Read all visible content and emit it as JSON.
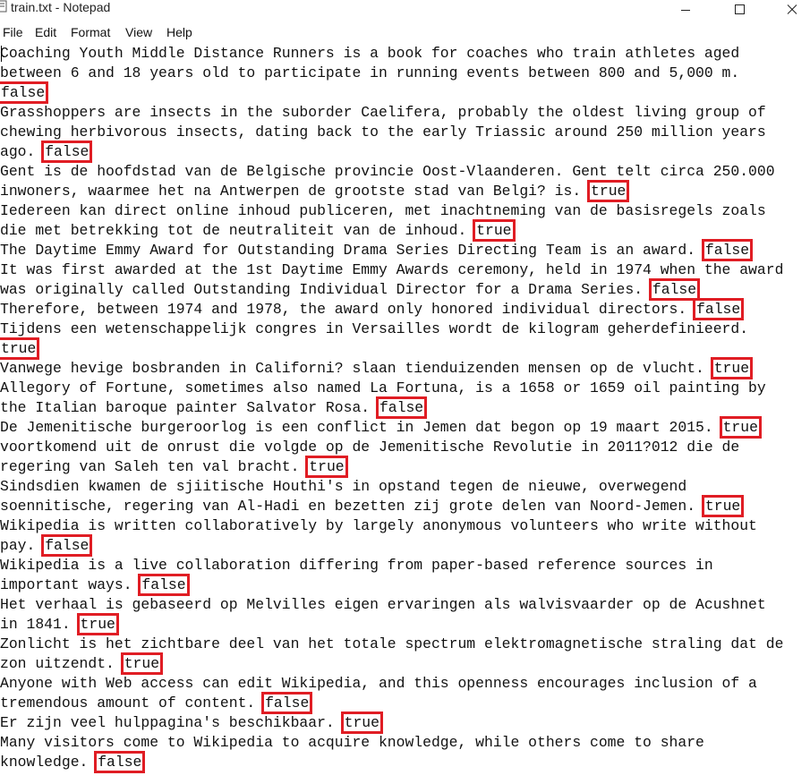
{
  "window": {
    "title": "train.txt - Notepad",
    "controls": [
      "minimize",
      "maximize",
      "close"
    ]
  },
  "menu": [
    "File",
    "Edit",
    "Format",
    "View",
    "Help"
  ],
  "document": {
    "lines": [
      {
        "text": "Coaching Youth Middle Distance Runners is a book for coaches who train athletes aged"
      },
      {
        "text": "between 6 and 18 years old to participate in running events between 800 and 5,000 m."
      },
      {
        "text": "",
        "label": "false"
      },
      {
        "text": "Grasshoppers are insects in the suborder Caelifera, probably the oldest living group of"
      },
      {
        "text": "chewing herbivorous insects, dating back to the early Triassic around 250 million years"
      },
      {
        "text": "ago. ",
        "label": "false"
      },
      {
        "text": "Gent is de hoofdstad van de Belgische provincie Oost-Vlaanderen. Gent telt circa 250.000"
      },
      {
        "text": "inwoners, waarmee het na Antwerpen de grootste stad van Belgi? is. ",
        "label": "true"
      },
      {
        "text": "Iedereen kan direct online inhoud publiceren, met inachtneming van de basisregels zoals"
      },
      {
        "text": "die met betrekking tot de neutraliteit van de inhoud. ",
        "label": "true"
      },
      {
        "text": "The Daytime Emmy Award for Outstanding Drama Series Directing Team is an award. ",
        "label": "false"
      },
      {
        "text": "It was first awarded at the 1st Daytime Emmy Awards ceremony, held in 1974 when the award"
      },
      {
        "text": "was originally called Outstanding Individual Director for a Drama Series. ",
        "label": "false"
      },
      {
        "text": "Therefore, between 1974 and 1978, the award only honored individual directors. ",
        "label": "false"
      },
      {
        "text": "Tijdens een wetenschappelijk congres in Versailles wordt de kilogram geherdefinieerd."
      },
      {
        "text": "",
        "label": "true"
      },
      {
        "text": "Vanwege hevige bosbranden in Californi? slaan tienduizenden mensen op de vlucht. ",
        "label": "true"
      },
      {
        "text": "Allegory of Fortune, sometimes also named La Fortuna, is a 1658 or 1659 oil painting by"
      },
      {
        "text": "the Italian baroque painter Salvator Rosa. ",
        "label": "false"
      },
      {
        "text": "De Jemenitische burgeroorlog is een conflict in Jemen dat begon op 19 maart 2015. ",
        "label": "true"
      },
      {
        "text": "voortkomend uit de onrust die volgde op de Jemenitische Revolutie in 2011?012 die de"
      },
      {
        "text": "regering van Saleh ten val bracht. ",
        "label": "true"
      },
      {
        "text": "Sindsdien kwamen de sjiitische Houthi's in opstand tegen de nieuwe, overwegend"
      },
      {
        "text": "soennitische, regering van Al-Hadi en bezetten zij grote delen van Noord-Jemen. ",
        "label": "true"
      },
      {
        "text": "Wikipedia is written collaboratively by largely anonymous volunteers who write without"
      },
      {
        "text": "pay. ",
        "label": "false"
      },
      {
        "text": "Wikipedia is a live collaboration differing from paper-based reference sources in"
      },
      {
        "text": "important ways. ",
        "label": "false"
      },
      {
        "text": "Het verhaal is gebaseerd op Melvilles eigen ervaringen als walvisvaarder op de Acushnet"
      },
      {
        "text": "in 1841. ",
        "label": "true"
      },
      {
        "text": "Zonlicht is het zichtbare deel van het totale spectrum elektromagnetische straling dat de"
      },
      {
        "text": "zon uitzendt. ",
        "label": "true"
      },
      {
        "text": "Anyone with Web access can edit Wikipedia, and this openness encourages inclusion of a"
      },
      {
        "text": "tremendous amount of content. ",
        "label": "false"
      },
      {
        "text": "Er zijn veel hulppagina's beschikbaar. ",
        "label": "true"
      },
      {
        "text": "Many visitors come to Wikipedia to acquire knowledge, while others come to share"
      },
      {
        "text": "knowledge. ",
        "label": "false"
      }
    ]
  },
  "colors": {
    "highlight_box": "#e01d24",
    "text": "#111111",
    "background": "#ffffff"
  },
  "icons": {
    "app": "notepad-icon",
    "minimize": "minimize-icon",
    "maximize": "maximize-icon",
    "close": "close-icon"
  }
}
